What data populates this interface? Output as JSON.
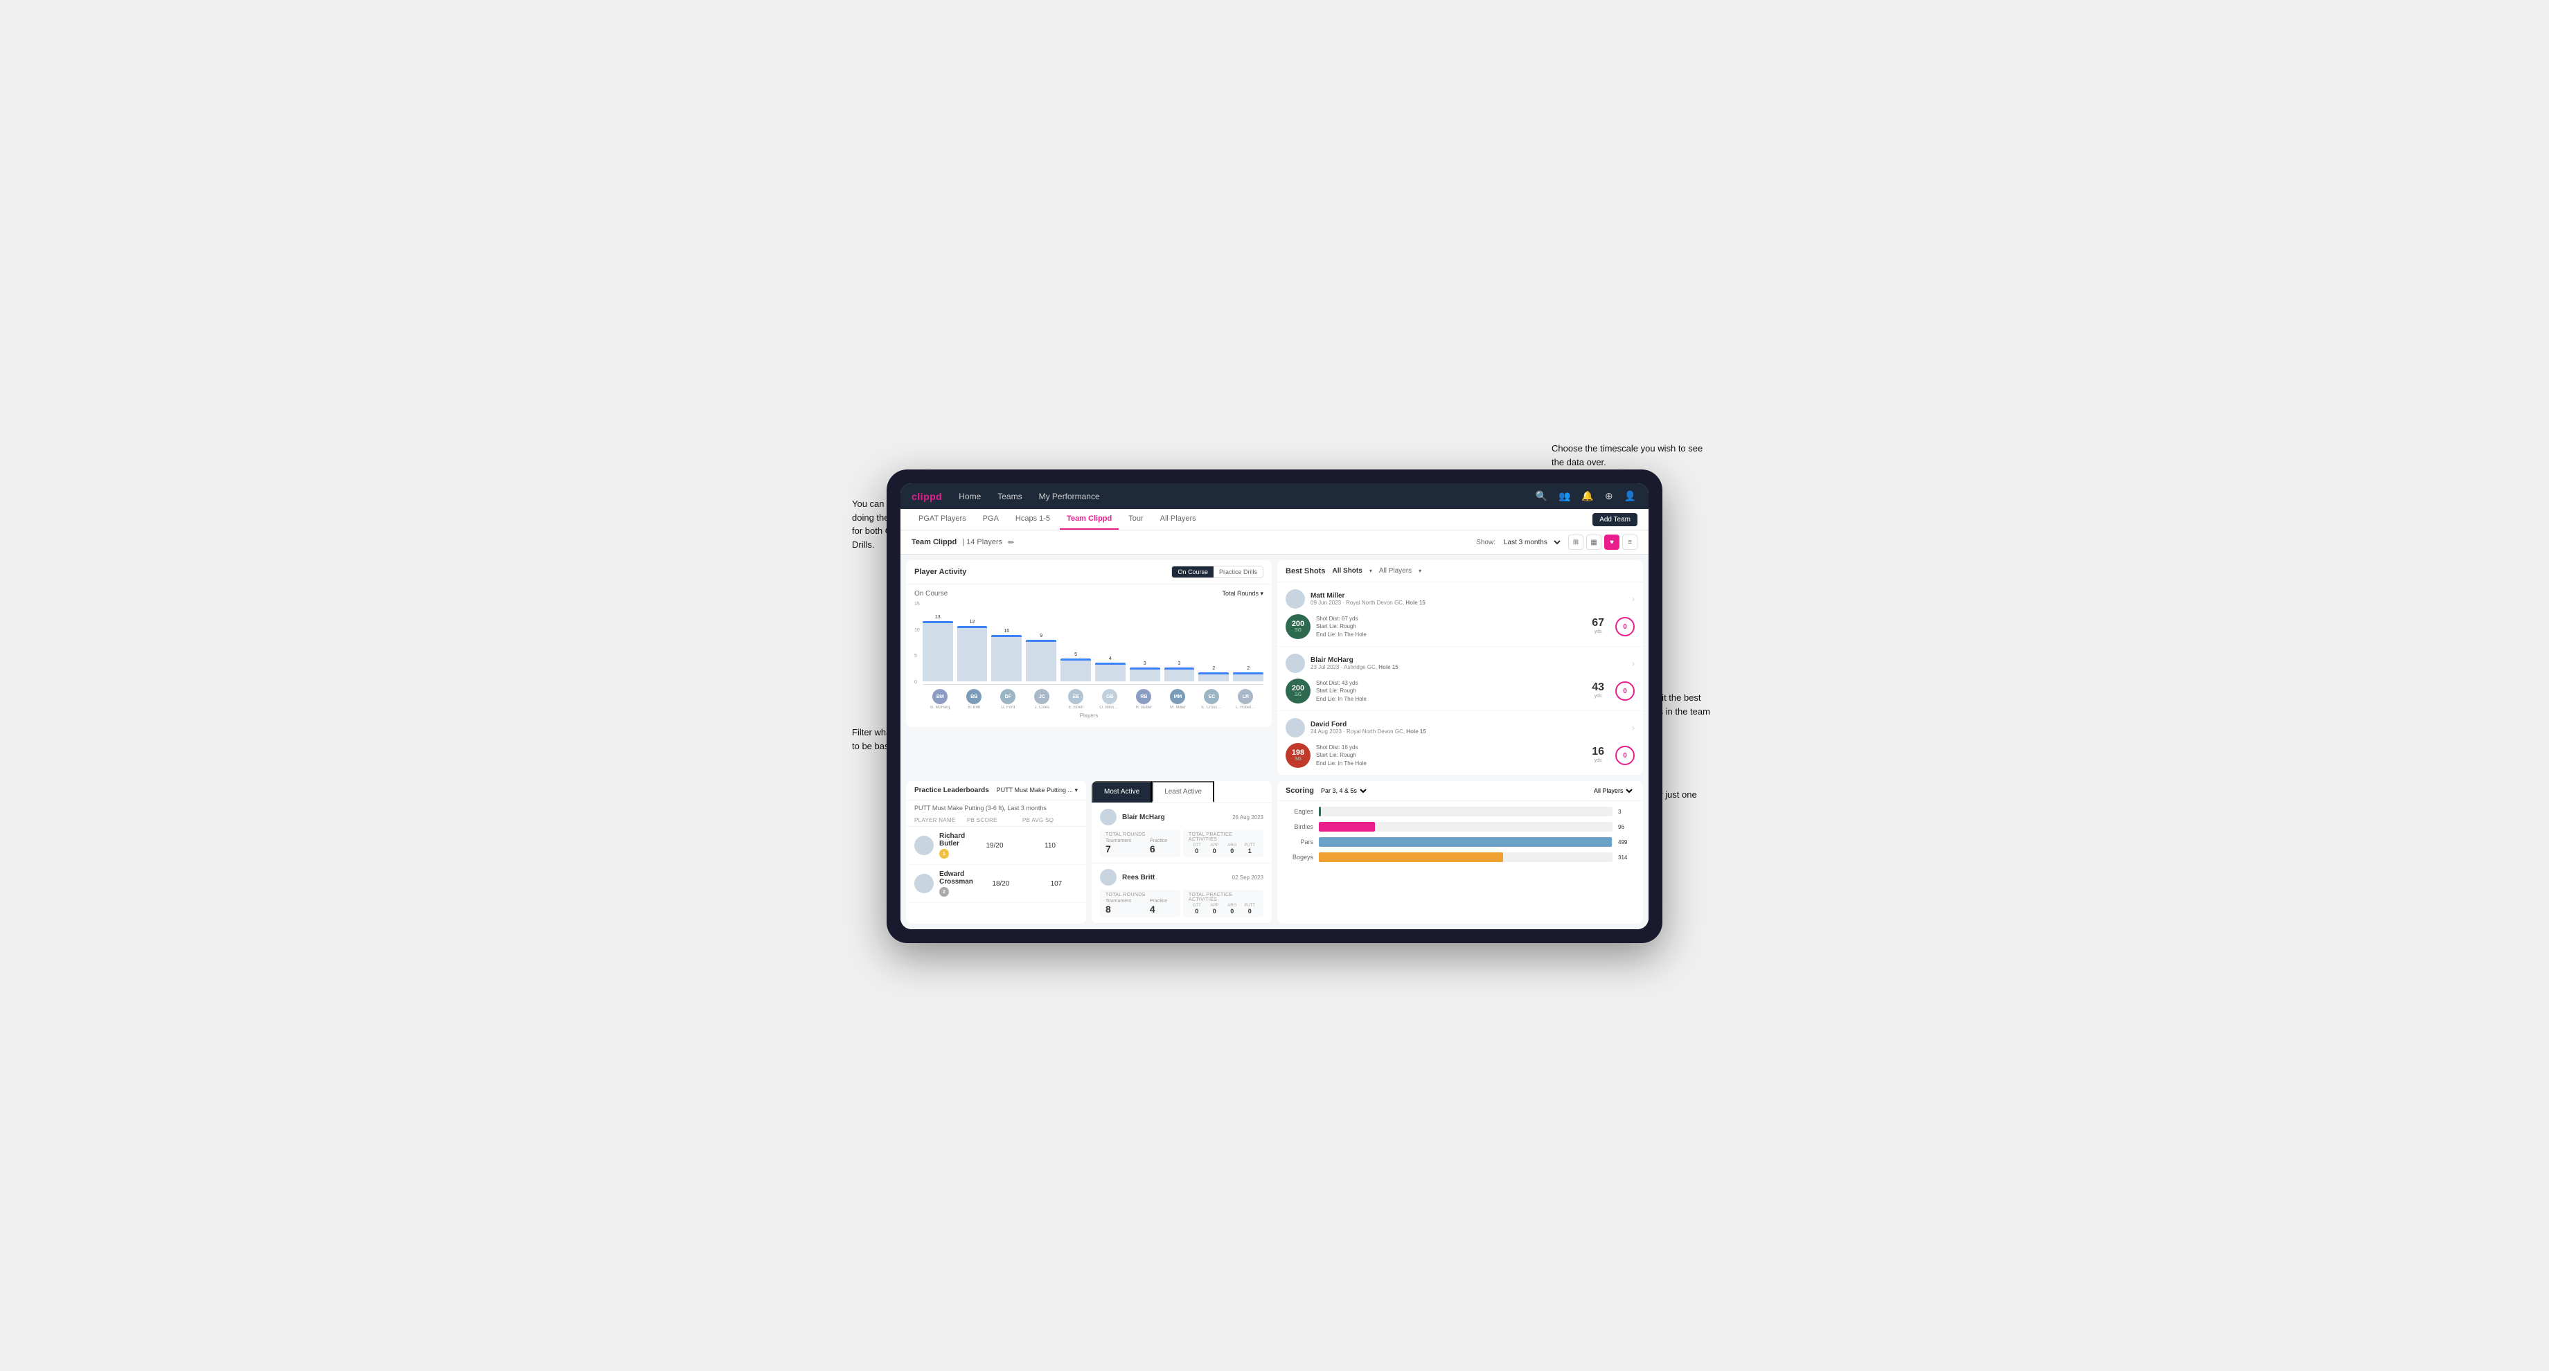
{
  "page": {
    "title": "Clippd - Team Clippd"
  },
  "annotations": {
    "top_right": "Choose the timescale you wish to see the data over.",
    "top_left": "You can select which player is doing the best in a range of areas for both On Course and Practice Drills.",
    "bottom_left": "Filter what data you wish the table to be based on.",
    "right_mid": "Here you can see who's hit the best shots out of all the players in the team for each department.",
    "right_bottom": "You can also filter to show just one player's best shots."
  },
  "nav": {
    "logo": "clippd",
    "items": [
      "Home",
      "Teams",
      "My Performance"
    ],
    "icons": [
      "search",
      "people",
      "bell",
      "add-circle",
      "person"
    ]
  },
  "sub_nav": {
    "tabs": [
      "PGAT Players",
      "PGA",
      "Hcaps 1-5",
      "Team Clippd",
      "Tour",
      "All Players"
    ],
    "active": "Team Clippd",
    "add_button": "Add Team"
  },
  "team_header": {
    "name": "Team Clippd",
    "separator": "|",
    "count": "14 Players",
    "show_label": "Show:",
    "time_range": "Last 3 months",
    "view_icons": [
      "grid",
      "grid-alt",
      "heart",
      "list"
    ]
  },
  "player_activity": {
    "title": "Player Activity",
    "toggle": {
      "options": [
        "On Course",
        "Practice Drills"
      ],
      "active": "On Course"
    },
    "chart": {
      "section": "On Course",
      "y_axis": [
        "15",
        "10",
        "5",
        "0"
      ],
      "y_title": "Total Rounds",
      "dropdown": "Total Rounds",
      "bars": [
        {
          "player": "B. McHarg",
          "value": 13,
          "height": 87
        },
        {
          "player": "B. Britt",
          "value": 12,
          "height": 80
        },
        {
          "player": "D. Ford",
          "value": 10,
          "height": 67
        },
        {
          "player": "J. Coles",
          "value": 9,
          "height": 60
        },
        {
          "player": "E. Ebert",
          "value": 5,
          "height": 33
        },
        {
          "player": "O. Billingham",
          "value": 4,
          "height": 27
        },
        {
          "player": "R. Butler",
          "value": 3,
          "height": 20
        },
        {
          "player": "M. Miller",
          "value": 3,
          "height": 20
        },
        {
          "player": "E. Crossman",
          "value": 2,
          "height": 13
        },
        {
          "player": "L. Robertson",
          "value": 2,
          "height": 13
        }
      ]
    },
    "x_label": "Players"
  },
  "best_shots": {
    "title": "Best Shots",
    "tabs": [
      "All Shots",
      "Players"
    ],
    "active_tab": "All Shots",
    "filter": "All Players",
    "players": [
      {
        "name": "Matt Miller",
        "date": "09 Jun 2023",
        "course": "Royal North Devon GC",
        "hole": "Hole 15",
        "badge_num": "200",
        "badge_sg": "SG",
        "badge_color": "green",
        "shot_dist": "Shot Dist: 67 yds",
        "start_lie": "Start Lie: Rough",
        "end_lie": "End Lie: In The Hole",
        "stat1_num": "67",
        "stat1_unit": "yds",
        "stat2_zero": "0",
        "stat2_unit": "yds"
      },
      {
        "name": "Blair McHarg",
        "date": "23 Jul 2023",
        "course": "Ashridge GC",
        "hole": "Hole 15",
        "badge_num": "200",
        "badge_sg": "SG",
        "badge_color": "green",
        "shot_dist": "Shot Dist: 43 yds",
        "start_lie": "Start Lie: Rough",
        "end_lie": "End Lie: In The Hole",
        "stat1_num": "43",
        "stat1_unit": "yds",
        "stat2_zero": "0",
        "stat2_unit": "yds"
      },
      {
        "name": "David Ford",
        "date": "24 Aug 2023",
        "course": "Royal North Devon GC",
        "hole": "Hole 15",
        "badge_num": "198",
        "badge_sg": "SG",
        "badge_color": "red",
        "shot_dist": "Shot Dist: 16 yds",
        "start_lie": "Start Lie: Rough",
        "end_lie": "End Lie: In The Hole",
        "stat1_num": "16",
        "stat1_unit": "yds",
        "stat2_zero": "0",
        "stat2_unit": "yds"
      }
    ]
  },
  "practice_leaderboards": {
    "title": "Practice Leaderboards",
    "dropdown": "PUTT Must Make Putting ...",
    "subtitle": "PUTT Must Make Putting (3-6 ft), Last 3 months",
    "columns": [
      "PLAYER NAME",
      "PB SCORE",
      "PB AVG SQ"
    ],
    "players": [
      {
        "name": "Richard Butler",
        "rank": "1",
        "rank_color": "gold",
        "pb_score": "19/20",
        "pb_avg_sq": "110"
      },
      {
        "name": "Edward Crossman",
        "rank": "2",
        "rank_color": "silver",
        "pb_score": "18/20",
        "pb_avg_sq": "107"
      }
    ]
  },
  "most_active": {
    "tabs": [
      "Most Active",
      "Least Active"
    ],
    "active_tab": "Most Active",
    "players": [
      {
        "name": "Blair McHarg",
        "date": "26 Aug 2023",
        "total_rounds_label": "Total Rounds",
        "tournament": "7",
        "practice": "6",
        "total_practice_label": "Total Practice Activities",
        "gtt": "0",
        "app": "0",
        "arg": "0",
        "putt": "1"
      },
      {
        "name": "Rees Britt",
        "date": "02 Sep 2023",
        "total_rounds_label": "Total Rounds",
        "tournament": "8",
        "practice": "4",
        "total_practice_label": "Total Practice Activities",
        "gtt": "0",
        "app": "0",
        "arg": "0",
        "putt": "0"
      }
    ]
  },
  "scoring": {
    "title": "Scoring",
    "dropdown": "Par 3, 4 & 5s",
    "filter": "All Players",
    "bars": [
      {
        "label": "Eagles",
        "value": 3,
        "max": 500,
        "color": "#2d6a4f"
      },
      {
        "label": "Birdies",
        "value": 96,
        "max": 500,
        "color": "#e91e8c"
      },
      {
        "label": "Pars",
        "value": 499,
        "max": 500,
        "color": "#6ba3c8"
      },
      {
        "label": "Bogeys",
        "value": 314,
        "max": 500,
        "color": "#f0a030"
      }
    ]
  }
}
